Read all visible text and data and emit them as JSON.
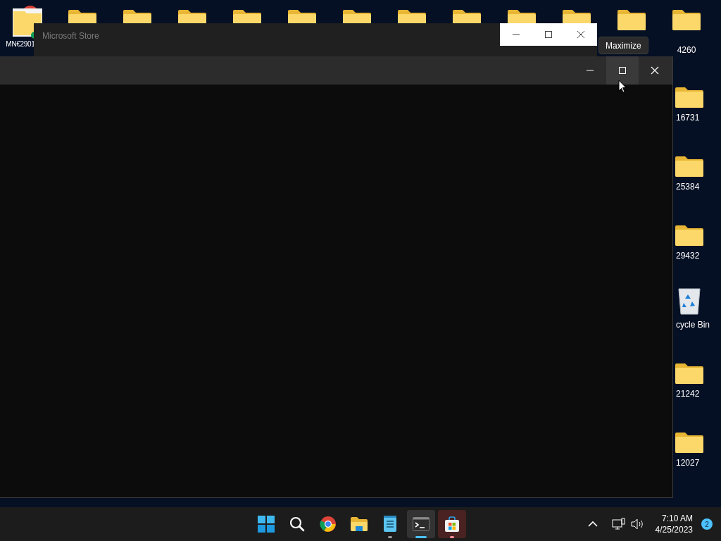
{
  "desktop": {
    "top_left_icon": {
      "kind": "shortcut",
      "label": "MN€2901"
    },
    "top_row": [
      {
        "kind": "folder"
      },
      {
        "kind": "folder"
      },
      {
        "kind": "folder"
      },
      {
        "kind": "folder"
      },
      {
        "kind": "folder"
      },
      {
        "kind": "folder"
      },
      {
        "kind": "folder"
      },
      {
        "kind": "folder"
      },
      {
        "kind": "folder"
      },
      {
        "kind": "folder"
      },
      {
        "kind": "folder"
      },
      {
        "kind": "folder",
        "label": "4260"
      }
    ],
    "right_column": [
      {
        "kind": "folder",
        "label": "16731"
      },
      {
        "kind": "folder",
        "label": "25384"
      },
      {
        "kind": "folder",
        "label": "29432"
      },
      {
        "kind": "recycle-bin",
        "label": "cycle Bin"
      },
      {
        "kind": "folder",
        "label": "21242"
      },
      {
        "kind": "folder",
        "label": "12027"
      }
    ]
  },
  "back_window": {
    "title": "Microsoft Store"
  },
  "front_window": {
    "maximize_hovered": true
  },
  "tooltip": "Maximize",
  "taskbar": {
    "apps": [
      {
        "kind": "start",
        "running": false,
        "active": false,
        "attention": false
      },
      {
        "kind": "search",
        "running": false,
        "active": false,
        "attention": false
      },
      {
        "kind": "chrome",
        "running": false,
        "active": false,
        "attention": false
      },
      {
        "kind": "explorer",
        "running": false,
        "active": false,
        "attention": false
      },
      {
        "kind": "notepad",
        "running": true,
        "active": false,
        "attention": false
      },
      {
        "kind": "terminal",
        "running": true,
        "active": true,
        "attention": false
      },
      {
        "kind": "store",
        "running": true,
        "active": false,
        "attention": true
      }
    ],
    "time": "7:10 AM",
    "date": "4/25/2023",
    "notifications": "2"
  }
}
